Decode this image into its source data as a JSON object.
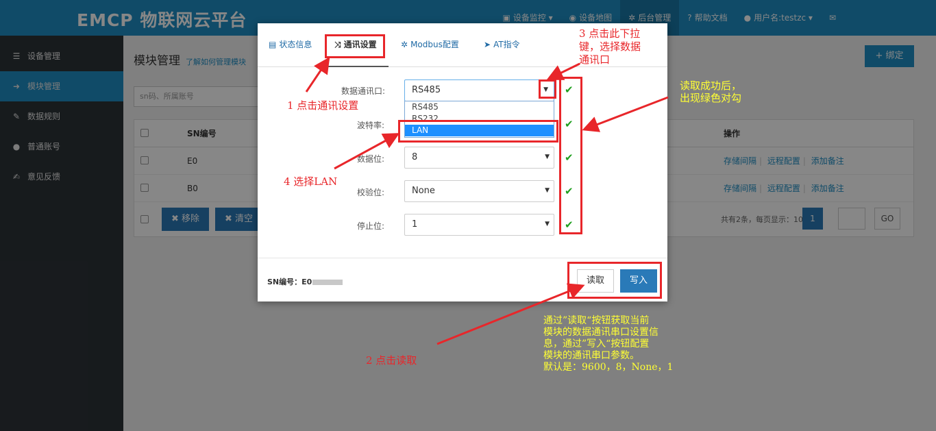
{
  "header": {
    "logo": "EMCP 物联网云平台",
    "nav": [
      {
        "label": "设备监控 ▾",
        "icon": "monitor-icon",
        "glyph": "▣"
      },
      {
        "label": "设备地图",
        "icon": "globe-icon",
        "glyph": "◉"
      },
      {
        "label": "后台管理",
        "icon": "gears-icon",
        "glyph": "✲"
      },
      {
        "label": "帮助文档",
        "icon": "help-icon",
        "glyph": "?"
      },
      {
        "label": "用户名:testzc ▾",
        "icon": "user-icon",
        "glyph": "●"
      },
      {
        "label": "",
        "icon": "mail-icon",
        "glyph": "✉"
      }
    ]
  },
  "sidebar": {
    "items": [
      {
        "label": "设备管理",
        "icon": "list-icon",
        "glyph": "☰"
      },
      {
        "label": "模块管理",
        "icon": "login-icon",
        "glyph": "➜"
      },
      {
        "label": "数据规则",
        "icon": "pencil-icon",
        "glyph": "✎"
      },
      {
        "label": "普通账号",
        "icon": "user-icon",
        "glyph": "●"
      },
      {
        "label": "意见反馈",
        "icon": "edit-icon",
        "glyph": "✍"
      }
    ]
  },
  "main": {
    "title": "模块管理",
    "help_link": "了解如何管理模块",
    "bind_button": "绑定",
    "bind_glyph": "+",
    "search_placeholder": "sn码、所属账号",
    "table": {
      "headers": {
        "sn": "SN编号",
        "ops": "操作"
      },
      "rows": [
        {
          "sn": "E0"
        },
        {
          "sn": "B0"
        }
      ],
      "ops": [
        "存储间隔",
        "远程配置",
        "添加备注"
      ],
      "remove_button": "移除",
      "clear_button": "清空",
      "btn_glyph": "✖",
      "pager_text": "共有2条，每页显示：10条",
      "page": "1",
      "go_button": "GO"
    }
  },
  "modal": {
    "tabs": [
      {
        "label": "状态信息",
        "icon": "list-icon",
        "glyph": "▤"
      },
      {
        "label": "通讯设置",
        "icon": "shuffle-icon",
        "glyph": "⤨"
      },
      {
        "label": "Modbus配置",
        "icon": "gear-icon",
        "glyph": "✲"
      },
      {
        "label": "AT指令",
        "icon": "send-icon",
        "glyph": "➤"
      }
    ],
    "fields": {
      "port_label": "数据通讯口:",
      "port_value": "RS485",
      "baud_label": "波特率:",
      "data_bits_label": "数据位:",
      "data_bits_value": "8",
      "parity_label": "校验位:",
      "parity_value": "None",
      "stop_bits_label": "停止位:",
      "stop_bits_value": "1"
    },
    "dropdown_options": [
      "RS485",
      "RS232",
      "LAN"
    ],
    "selected_option": "LAN",
    "arrow_glyph": "▼",
    "check_glyph": "✔",
    "sn_label": "SN编号：E0",
    "read_button": "读取",
    "write_button": "写入"
  },
  "annotations": {
    "step1": "1  点击通讯设置",
    "step2": "2  点击读取",
    "step3_line1": "3  点击此下拉",
    "step3_line2": "键，选择数据",
    "step3_line3": "通讯口",
    "step4": "4  选择LAN",
    "success_line1": "读取成功后，",
    "success_line2": "出现绿色对勾",
    "note_line1": "通过”读取“按钮获取当前",
    "note_line2": "模块的数据通讯串口设置信",
    "note_line3": "息，通过”写入“按钮配置",
    "note_line4": "模块的通讯串口参数。",
    "note_line5": "默认是：9600，8，None，1"
  }
}
